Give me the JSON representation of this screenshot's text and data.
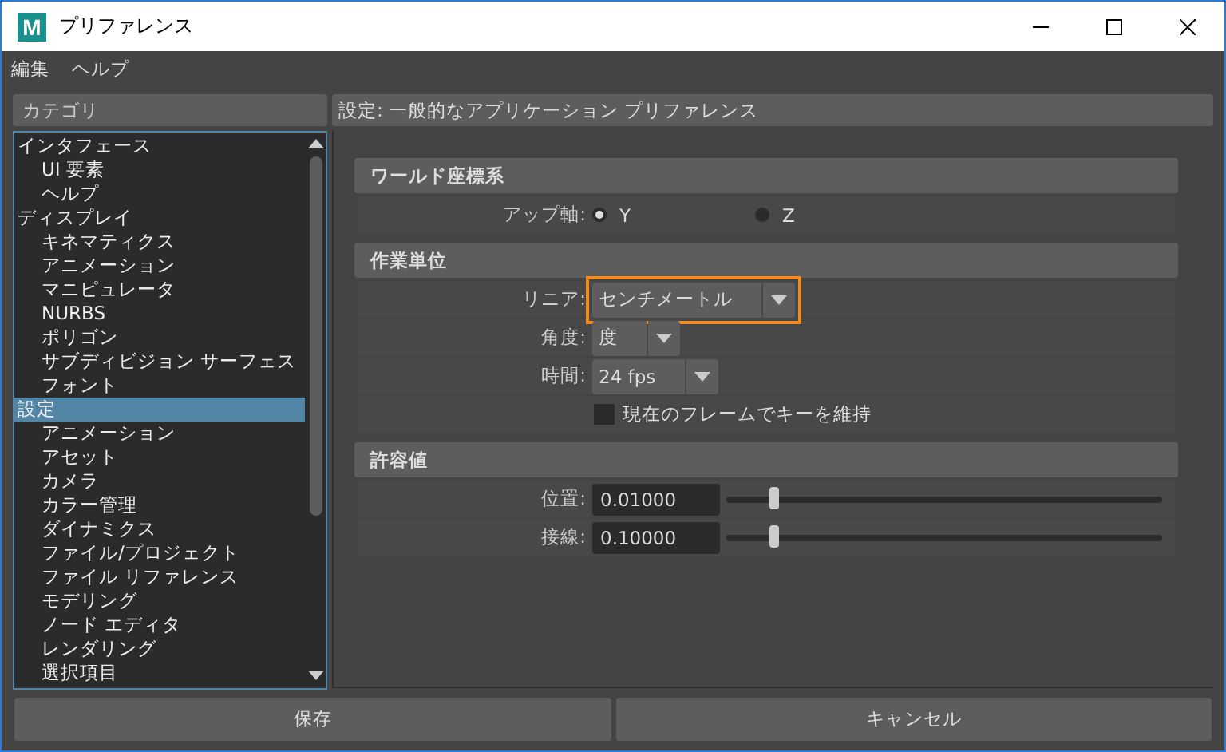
{
  "window": {
    "title": "プリファレンス",
    "logo": "M"
  },
  "menu": [
    "編集",
    "ヘルプ"
  ],
  "sidebar": {
    "header": "カテゴリ",
    "items": [
      {
        "label": "インタフェース",
        "selected": false,
        "children": [
          {
            "label": "UI 要素",
            "selected": false
          },
          {
            "label": "ヘルプ",
            "selected": false
          }
        ]
      },
      {
        "label": "ディスプレイ",
        "selected": false,
        "children": [
          {
            "label": "キネマティクス",
            "selected": false
          },
          {
            "label": "アニメーション",
            "selected": false
          },
          {
            "label": "マニピュレータ",
            "selected": false
          },
          {
            "label": "NURBS",
            "selected": false
          },
          {
            "label": "ポリゴン",
            "selected": false
          },
          {
            "label": "サブディビジョン サーフェス",
            "selected": false
          },
          {
            "label": "フォント",
            "selected": false
          }
        ]
      },
      {
        "label": "設定",
        "selected": true,
        "children": [
          {
            "label": "アニメーション",
            "selected": false
          },
          {
            "label": "アセット",
            "selected": false
          },
          {
            "label": "カメラ",
            "selected": false
          },
          {
            "label": "カラー管理",
            "selected": false
          },
          {
            "label": "ダイナミクス",
            "selected": false
          },
          {
            "label": "ファイル/プロジェクト",
            "selected": false
          },
          {
            "label": "ファイル リファレンス",
            "selected": false
          },
          {
            "label": "モデリング",
            "selected": false
          },
          {
            "label": "ノード エディタ",
            "selected": false
          },
          {
            "label": "レンダリング",
            "selected": false
          },
          {
            "label": "選択項目",
            "selected": false
          }
        ]
      }
    ]
  },
  "content": {
    "header": "設定: 一般的なアプリケーション プリファレンス",
    "sections": [
      {
        "title": "ワールド座標系",
        "rows": [
          {
            "kind": "radio",
            "label": "アップ軸:",
            "options": [
              {
                "label": "Y",
                "selected": true
              },
              {
                "label": "Z",
                "selected": false
              }
            ]
          }
        ]
      },
      {
        "title": "作業単位",
        "rows": [
          {
            "kind": "dropdown",
            "label": "リニア:",
            "value": "センチメートル",
            "highlighted": true
          },
          {
            "kind": "dropdown",
            "label": "角度:",
            "value": "度",
            "highlighted": false
          },
          {
            "kind": "dropdown",
            "label": "時間:",
            "value": "24 fps",
            "highlighted": false
          },
          {
            "kind": "checkbox",
            "label": "現在のフレームでキーを維持",
            "checked": false
          }
        ]
      },
      {
        "title": "許容値",
        "rows": [
          {
            "kind": "slider",
            "label": "位置:",
            "value": "0.01000",
            "level": 0.11
          },
          {
            "kind": "slider",
            "label": "接線:",
            "value": "0.10000",
            "level": 0.11
          }
        ]
      }
    ]
  },
  "buttons": [
    "保存",
    "キャンセル"
  ]
}
